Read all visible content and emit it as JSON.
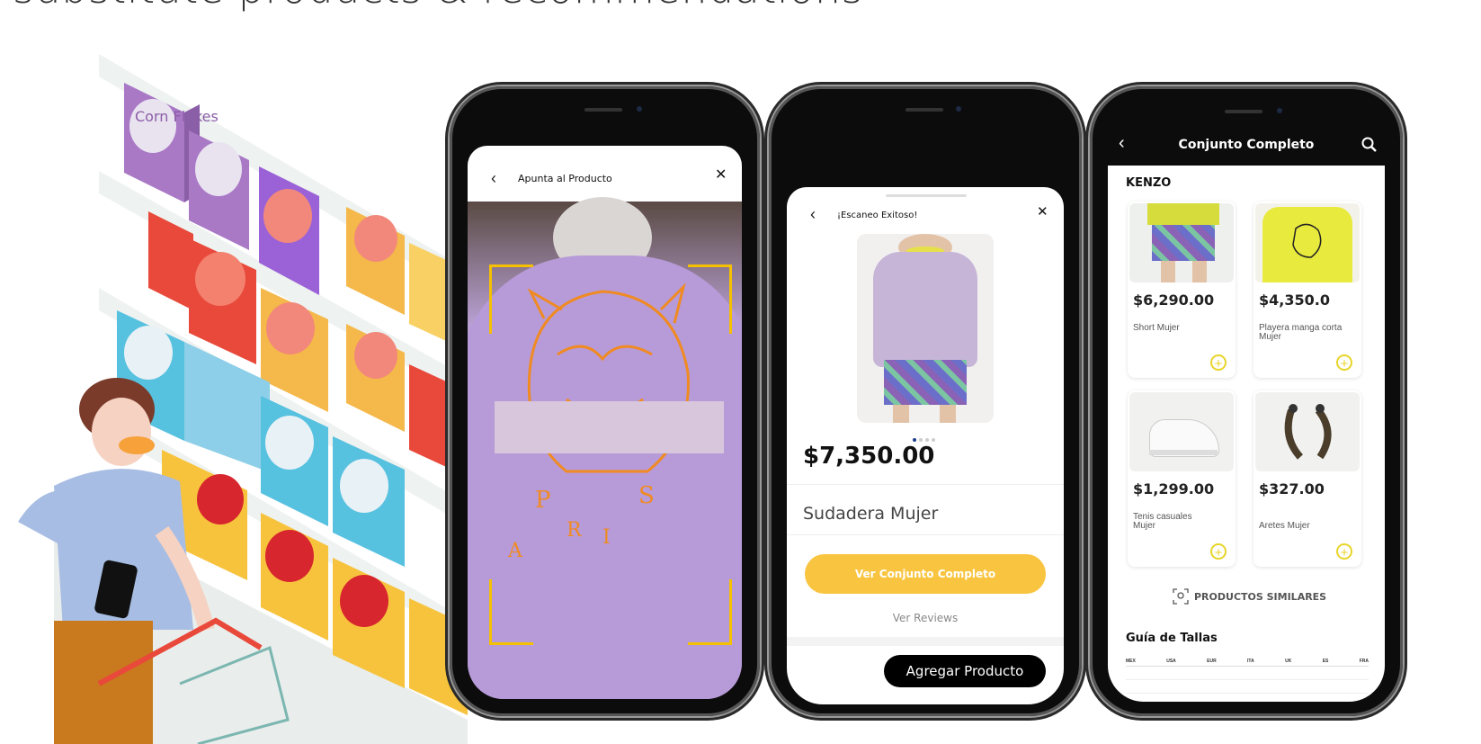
{
  "headline": "substitute products & recommendations",
  "illustration": {
    "box_label": "Corn Flakes"
  },
  "phone1": {
    "header_title": "Apunta al Producto",
    "back_icon": "chevron-left-icon",
    "close_icon": "close-icon"
  },
  "phone2": {
    "header_title": "¡Escaneo Exitoso!",
    "price": "$7,350.00",
    "product_name": "Sudadera Mujer",
    "primary_button": "Ver Conjunto Completo",
    "reviews_link": "Ver Reviews",
    "add_button": "Agregar Producto",
    "accent": "#f9c540"
  },
  "phone3": {
    "title": "Conjunto Completo",
    "brand": "KENZO",
    "products": [
      {
        "price": "$6,290.00",
        "name": "Short Mujer"
      },
      {
        "price": "$4,350.0",
        "name": "Playera manga corta Mujer"
      },
      {
        "price": "$1,299.00",
        "name": "Tenis casuales Mujer"
      },
      {
        "price": "$327.00",
        "name": "Aretes Mujer"
      }
    ],
    "similar_label": "PRODUCTOS SIMILARES",
    "size_guide_title": "Guía de Tallas",
    "size_columns": [
      "MEX",
      "USA",
      "EUR",
      "ITA",
      "UK",
      "ES",
      "FRA"
    ]
  }
}
